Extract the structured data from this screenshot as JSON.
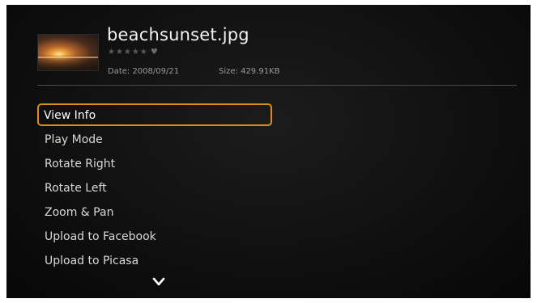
{
  "file": {
    "name": "beachsunset.jpg",
    "rating_stars": "★★★★★",
    "favorite_glyph": "♥",
    "date_label": "Date: 2008/09/21",
    "size_label": "Size: 429.91KB",
    "thumbnail": "beach-sunset-thumbnail"
  },
  "menu": {
    "selected_index": 0,
    "items": [
      {
        "label": "View Info"
      },
      {
        "label": "Play Mode"
      },
      {
        "label": "Rotate Right"
      },
      {
        "label": "Rotate Left"
      },
      {
        "label": "Zoom & Pan"
      },
      {
        "label": "Upload to Facebook"
      },
      {
        "label": "Upload to Picasa"
      }
    ]
  },
  "icons": {
    "scroll_more": "chevron-down-icon"
  },
  "colors": {
    "background": "#111111",
    "selection": "#e08a1e",
    "text": "#e9e9e9",
    "muted": "#9a9a9a"
  }
}
